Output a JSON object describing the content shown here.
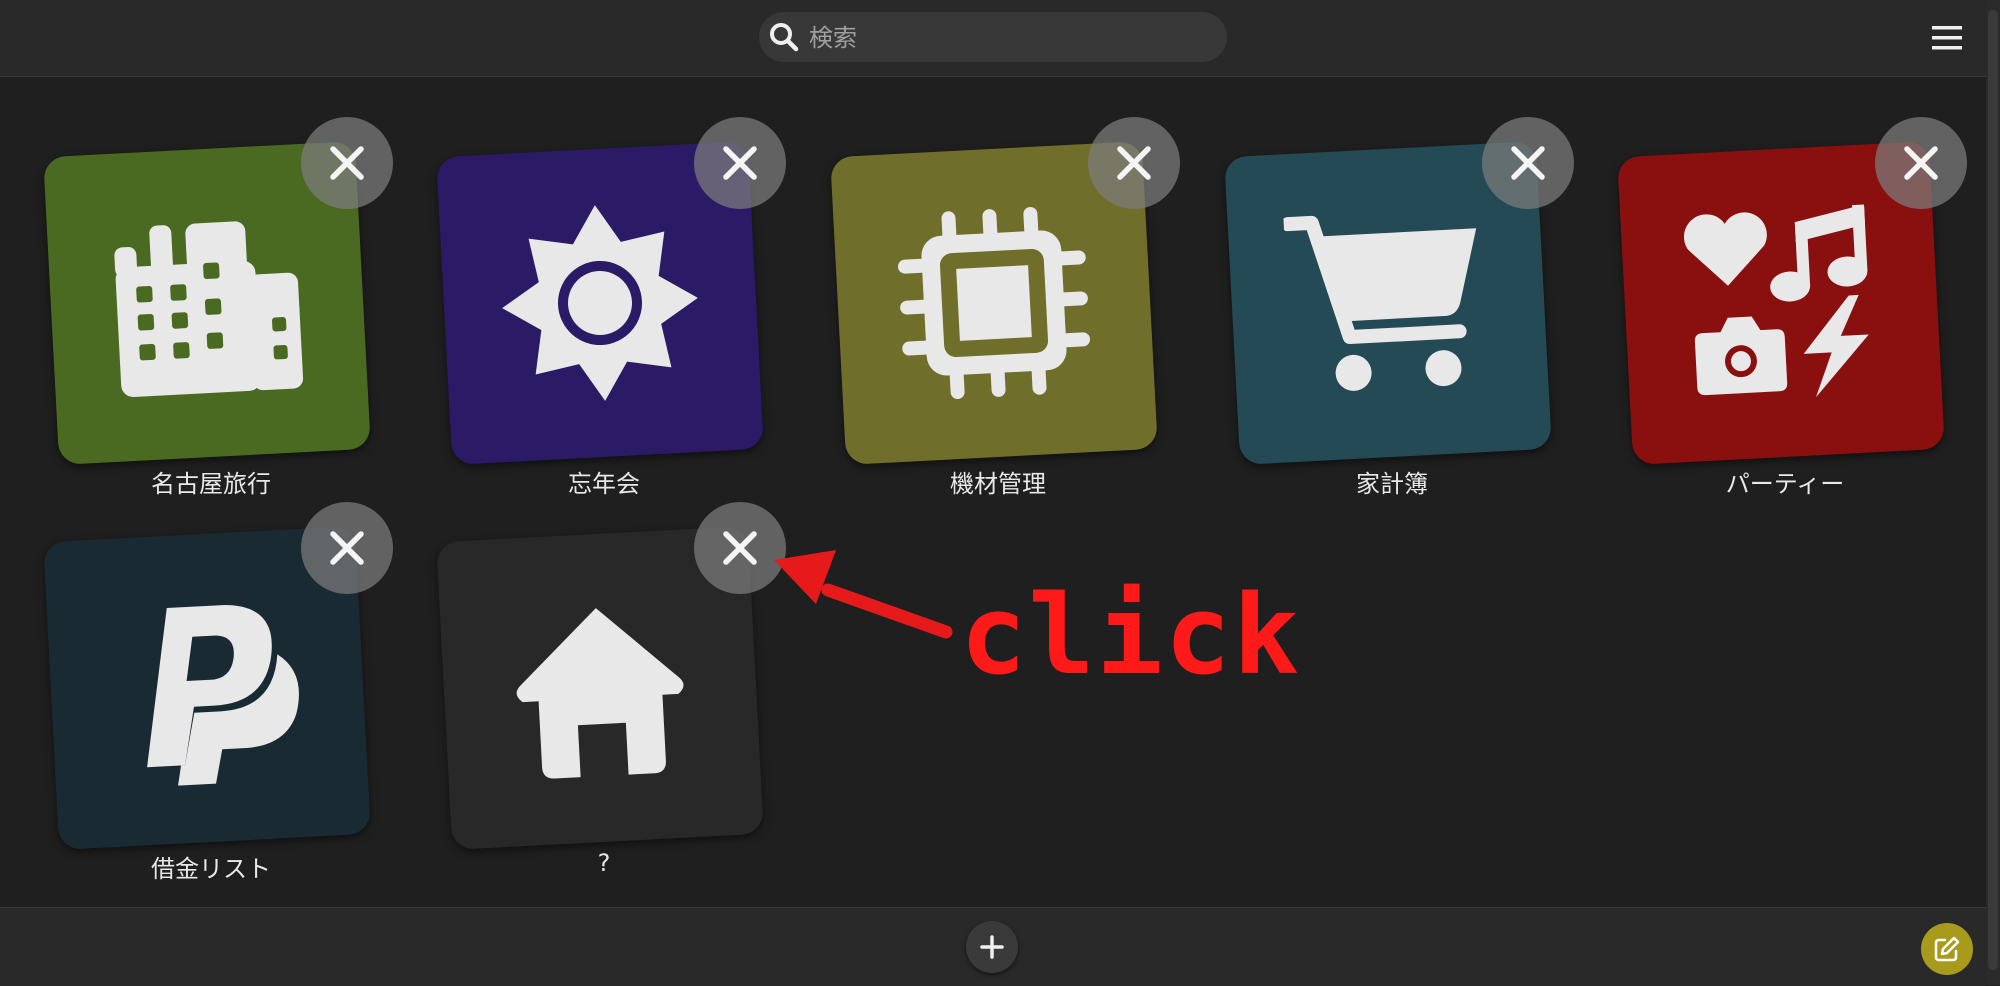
{
  "search": {
    "placeholder": "検索",
    "value": ""
  },
  "tiles": [
    {
      "label": "名古屋旅行",
      "color": "#4a6a22",
      "icon": "building-icon"
    },
    {
      "label": "忘年会",
      "color": "#2b1a66",
      "icon": "sun-icon"
    },
    {
      "label": "機材管理",
      "color": "#6f6e2a",
      "icon": "chip-icon"
    },
    {
      "label": "家計簿",
      "color": "#234a55",
      "icon": "cart-icon"
    },
    {
      "label": "パーティー",
      "color": "#8a1010",
      "icon": "party-icon"
    },
    {
      "label": "借金リスト",
      "color": "#1a2a33",
      "icon": "paypal-icon"
    },
    {
      "label": "?",
      "color": "#282828",
      "icon": "home-icon"
    }
  ],
  "annotation": {
    "text": "click",
    "color": "#ff1a1a"
  },
  "edit_button": {
    "color": "#a89a1c"
  }
}
